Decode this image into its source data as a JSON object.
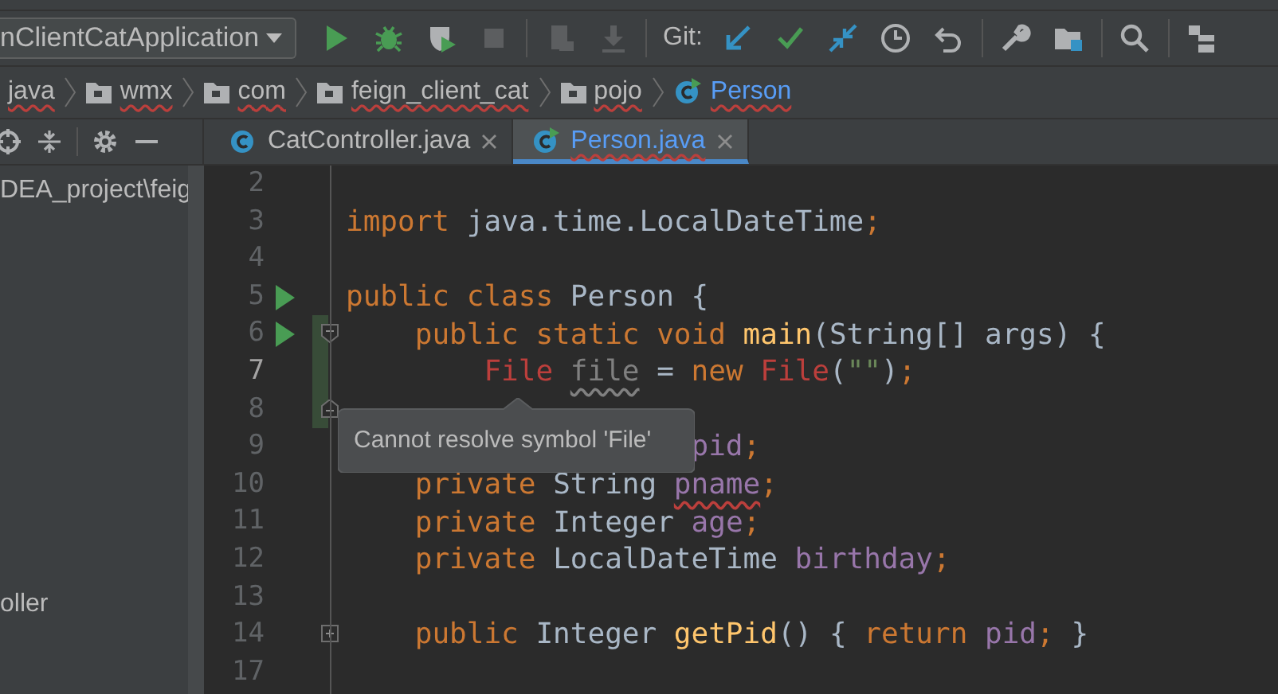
{
  "toolbar": {
    "run_config": "nClientCatApplication",
    "git_label": "Git:"
  },
  "breadcrumbs": [
    {
      "label": "java",
      "kind": "text"
    },
    {
      "label": "wmx",
      "kind": "folder"
    },
    {
      "label": "com",
      "kind": "folder"
    },
    {
      "label": "feign_client_cat",
      "kind": "folder"
    },
    {
      "label": "pojo",
      "kind": "folder"
    },
    {
      "label": "Person",
      "kind": "class"
    }
  ],
  "tabs": [
    {
      "label": "CatController.java",
      "selected": false,
      "runnable": false
    },
    {
      "label": "Person.java",
      "selected": true,
      "runnable": true
    }
  ],
  "project_panel": {
    "path": "DEA_project\\feig",
    "item": "oller"
  },
  "editor": {
    "lines": [
      {
        "number": "2",
        "current": false,
        "run": false,
        "changed": false
      },
      {
        "number": "3",
        "current": false,
        "run": false,
        "changed": false,
        "tokens": [
          {
            "text": "import ",
            "kind": "keyword"
          },
          {
            "text": "java.time.LocalDateTime",
            "kind": "plain"
          },
          {
            "text": ";",
            "kind": "keyword"
          }
        ]
      },
      {
        "number": "4",
        "current": false,
        "run": false,
        "changed": false
      },
      {
        "number": "5",
        "current": false,
        "run": true,
        "changed": false,
        "tokens": [
          {
            "text": "public class ",
            "kind": "keyword"
          },
          {
            "text": "Person {",
            "kind": "plain"
          }
        ]
      },
      {
        "number": "6",
        "current": false,
        "run": true,
        "changed": true,
        "markers": [
          {
            "kind": "fold_start"
          }
        ],
        "tokens": [
          {
            "text": "    public static void ",
            "kind": "keyword"
          },
          {
            "text": "main",
            "kind": "method"
          },
          {
            "text": "(String[] args) {",
            "kind": "plain"
          }
        ]
      },
      {
        "number": "7",
        "current": true,
        "run": false,
        "changed": true,
        "tokens": [
          {
            "text": "        File ",
            "kind": "error"
          },
          {
            "text": "file",
            "kind": "unused"
          },
          {
            "text": " = ",
            "kind": "plain"
          },
          {
            "text": "new ",
            "kind": "keyword"
          },
          {
            "text": "File",
            "kind": "error"
          },
          {
            "text": "(",
            "kind": "plain"
          },
          {
            "text": "\"\"",
            "kind": "string"
          },
          {
            "text": ")",
            "kind": "plain"
          },
          {
            "text": ";",
            "kind": "keyword"
          }
        ]
      },
      {
        "number": "8",
        "current": false,
        "run": false,
        "changed": true,
        "markers": [
          {
            "kind": "fold_end"
          }
        ]
      },
      {
        "number": "9",
        "current": false,
        "run": false,
        "changed": false,
        "tokens": [
          {
            "text": "                    pid",
            "kind": "field"
          },
          {
            "text": ";",
            "kind": "keyword"
          }
        ]
      },
      {
        "number": "10",
        "current": false,
        "run": false,
        "changed": false,
        "tokens": [
          {
            "text": "    private ",
            "kind": "keyword"
          },
          {
            "text": "String ",
            "kind": "plain"
          },
          {
            "text": "pname",
            "kind": "field_typo"
          },
          {
            "text": ";",
            "kind": "keyword"
          }
        ]
      },
      {
        "number": "11",
        "current": false,
        "run": false,
        "changed": false,
        "tokens": [
          {
            "text": "    private ",
            "kind": "keyword"
          },
          {
            "text": "Integer ",
            "kind": "plain"
          },
          {
            "text": "age",
            "kind": "field"
          },
          {
            "text": ";",
            "kind": "keyword"
          }
        ]
      },
      {
        "number": "12",
        "current": false,
        "run": false,
        "changed": false,
        "tokens": [
          {
            "text": "    private ",
            "kind": "keyword"
          },
          {
            "text": "LocalDateTime ",
            "kind": "plain"
          },
          {
            "text": "birthday",
            "kind": "field"
          },
          {
            "text": ";",
            "kind": "keyword"
          }
        ]
      },
      {
        "number": "13",
        "current": false,
        "run": false,
        "changed": false
      },
      {
        "number": "14",
        "current": false,
        "run": false,
        "changed": false,
        "markers": [
          {
            "kind": "folded"
          }
        ],
        "tokens": [
          {
            "text": "    public ",
            "kind": "keyword"
          },
          {
            "text": "Integer ",
            "kind": "plain"
          },
          {
            "text": "getPid",
            "kind": "method"
          },
          {
            "text": "() { ",
            "kind": "plain"
          },
          {
            "text": "return ",
            "kind": "keyword"
          },
          {
            "text": "pid",
            "kind": "field"
          },
          {
            "text": "; ",
            "kind": "keyword"
          },
          {
            "text": "}",
            "kind": "plain"
          }
        ]
      },
      {
        "number": "17",
        "current": false,
        "run": false,
        "changed": false
      }
    ]
  },
  "tooltip": {
    "text": "Cannot resolve symbol 'File'"
  }
}
